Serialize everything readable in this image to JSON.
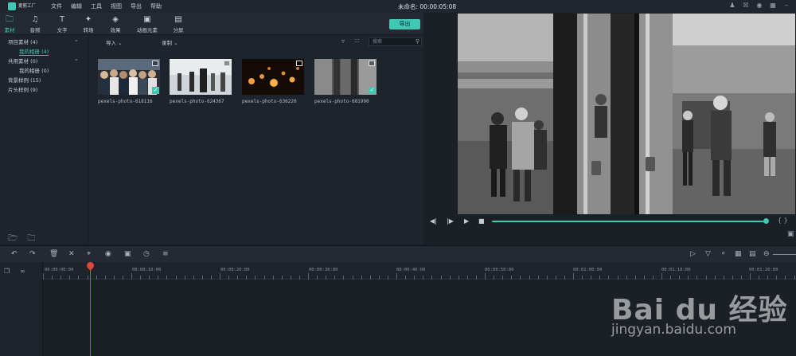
{
  "app": {
    "logo_text": "爱剪工厂",
    "menu": [
      "文件",
      "编辑",
      "工具",
      "视图",
      "导出",
      "帮助"
    ],
    "project_title": "未命名: 00:00:05:08"
  },
  "toolbar": {
    "tabs": [
      {
        "label": "素材",
        "icon": "folder-icon"
      },
      {
        "label": "音频",
        "icon": "music-icon"
      },
      {
        "label": "文字",
        "icon": "text-icon"
      },
      {
        "label": "转场",
        "icon": "transition-icon"
      },
      {
        "label": "效果",
        "icon": "effect-icon"
      },
      {
        "label": "动画元素",
        "icon": "image-icon"
      },
      {
        "label": "分屏",
        "icon": "split-screen-icon"
      }
    ],
    "active_tab": "素材",
    "export_label": "导出"
  },
  "tree": {
    "items": [
      {
        "label": "项目素材 (4)"
      },
      {
        "label": "我的相册 (4)"
      },
      {
        "label": "共用素材 (0)"
      },
      {
        "label": "我的相册 (0)"
      },
      {
        "label": "背景样例 (15)"
      },
      {
        "label": "片头样例 (9)"
      }
    ]
  },
  "filter": {
    "import_label": "导入",
    "record_label": "录制",
    "search_placeholder": "搜索"
  },
  "media": [
    {
      "name": "pexels-photo-618116",
      "checked": true
    },
    {
      "name": "pexels-photo-624367",
      "checked": false
    },
    {
      "name": "pexels-photo-636220",
      "checked": false
    },
    {
      "name": "pexels-photo-681990",
      "checked": true
    }
  ],
  "timeline": {
    "ticks": [
      "00:00:00:00",
      "00:00:10:00",
      "00:00:20:00",
      "00:00:30:00",
      "00:00:40:00",
      "00:00:50:00",
      "00:01:00:00",
      "00:01:10:00",
      "00:01:20:00"
    ]
  },
  "watermark": {
    "brand": "Bai du 经验",
    "url": "jingyan.baidu.com"
  },
  "colors": {
    "accent": "#41c8b5",
    "playhead": "#e0463c"
  }
}
